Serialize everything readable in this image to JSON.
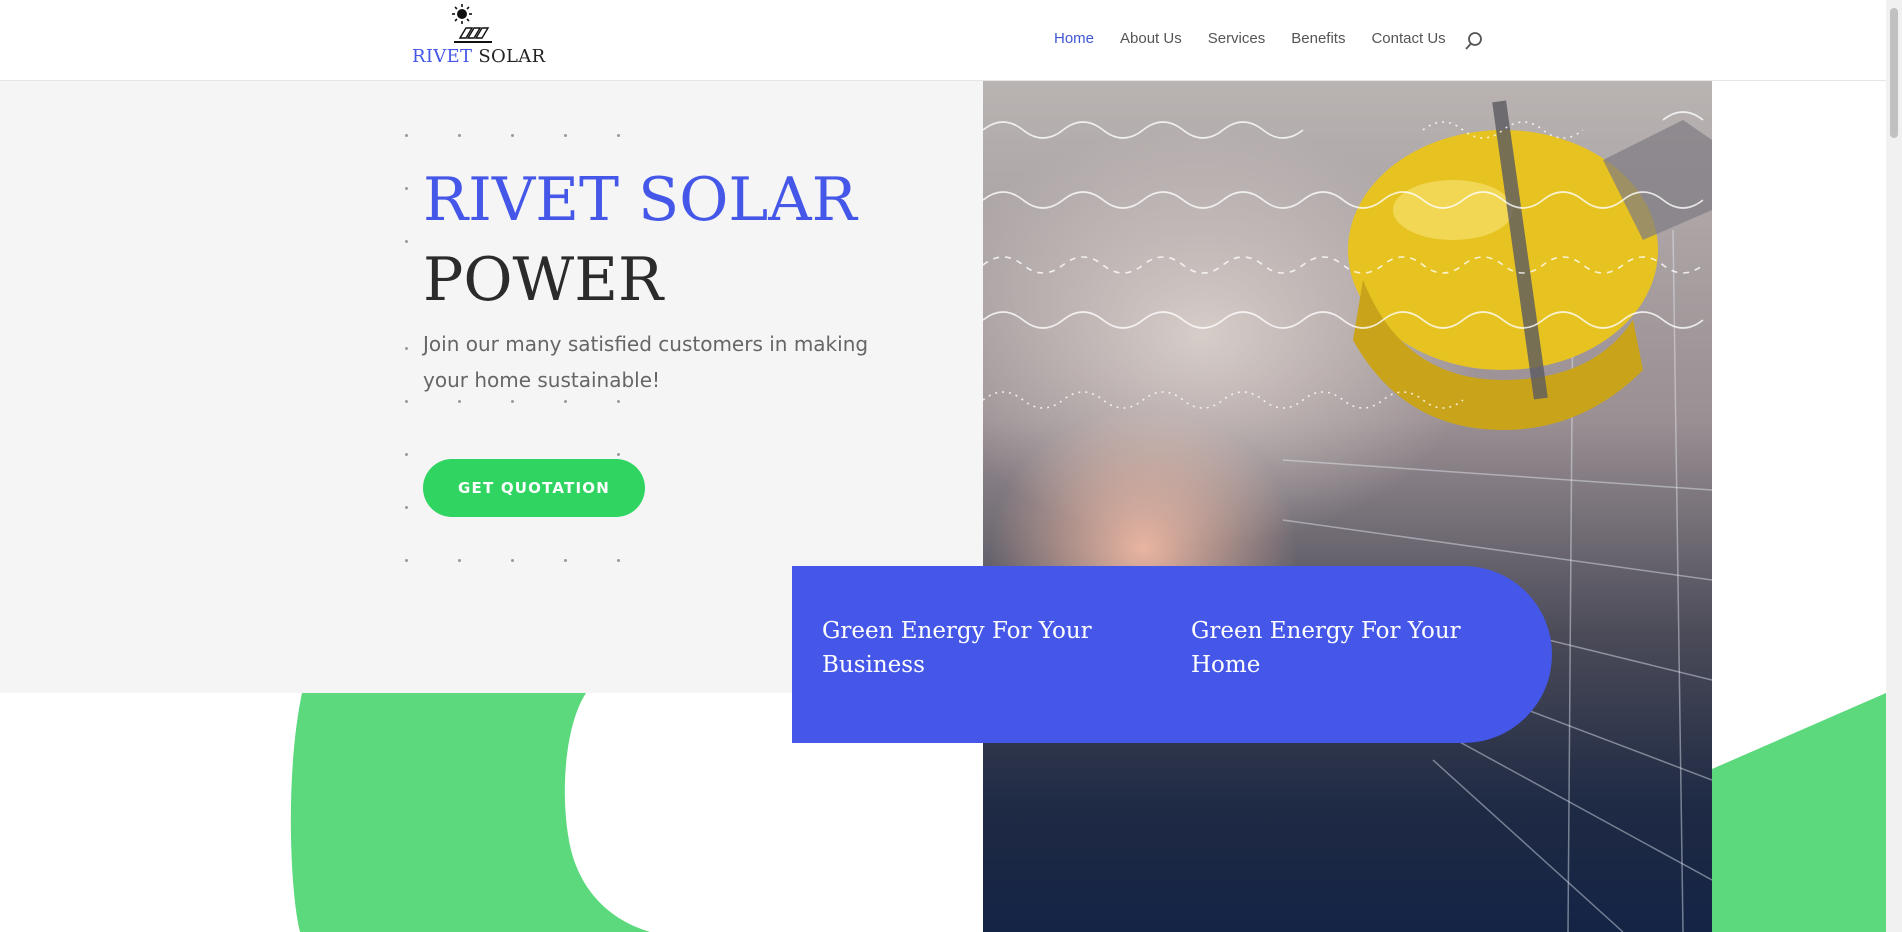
{
  "header": {
    "logo": {
      "text_blue": "RIVET",
      "text_dark": "SOLAR",
      "icon": "solar-panel-sun-icon"
    },
    "nav": [
      {
        "label": "Home",
        "active": true
      },
      {
        "label": "About Us",
        "active": false
      },
      {
        "label": "Services",
        "active": false
      },
      {
        "label": "Benefits",
        "active": false
      },
      {
        "label": "Contact Us",
        "active": false
      }
    ],
    "search_icon": "search-icon"
  },
  "hero": {
    "title_line1": "RIVET SOLAR",
    "title_line2": "POWER",
    "subtitle": "Join our many satisfied customers in making your home sustainable!",
    "cta_label": "GET QUOTATION",
    "image": "worker-yellow-hard-hat-solar-panel"
  },
  "cards": [
    {
      "label": "Green Energy For Your Business"
    },
    {
      "label": "Green Energy For Your Home"
    }
  ],
  "colors": {
    "brand_blue": "#4557e8",
    "cta_green": "#2fd461",
    "shape_green": "#5cd97c",
    "hero_bg": "#f5f5f5"
  }
}
